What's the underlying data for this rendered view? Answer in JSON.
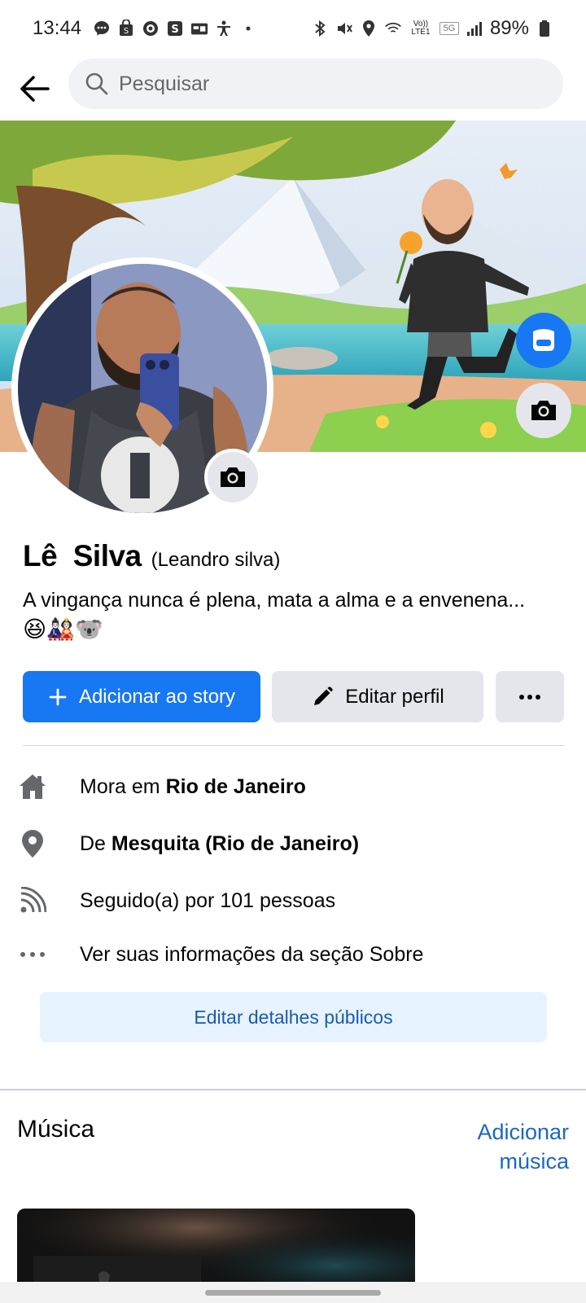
{
  "status_bar": {
    "time": "13:44",
    "left_icons": [
      "messenger-icon",
      "shop-icon",
      "steering-wheel-icon",
      "s-app-icon",
      "wallet-icon",
      "accessibility-icon",
      "dot-icon"
    ],
    "right_icons": [
      "bluetooth-icon",
      "mute-icon",
      "location-icon",
      "wifi-icon",
      "volte-icon",
      "5g-icon",
      "signal-icon"
    ],
    "volte_label": "Vo)) LTE1",
    "network_label": "5G",
    "battery": "89%"
  },
  "search": {
    "placeholder": "Pesquisar"
  },
  "profile": {
    "name": "Lê  Silva",
    "alternate_name": "(Leandro silva)",
    "bio": "A vingança nunca é plena, mata a alma e a envenena...",
    "bio_emoji": "😆🎎🐨"
  },
  "actions": {
    "add_story": "Adicionar ao story",
    "edit_profile": "Editar perfil"
  },
  "details": {
    "lives_prefix": "Mora em ",
    "lives_city": "Rio de Janeiro",
    "from_prefix": "De ",
    "from_city": "Mesquita (Rio de Janeiro)",
    "followers": "Seguido(a) por 101 pessoas",
    "about": "Ver suas informações da seção Sobre"
  },
  "edit_public_details": "Editar detalhes públicos",
  "music": {
    "title": "Música",
    "add_line1": "Adicionar",
    "add_line2": "música"
  },
  "colors": {
    "primary_blue": "#1877f2",
    "light_blue_bg": "#e7f3ff",
    "gray_button": "#e4e6eb",
    "link_blue": "#1a66c9"
  }
}
